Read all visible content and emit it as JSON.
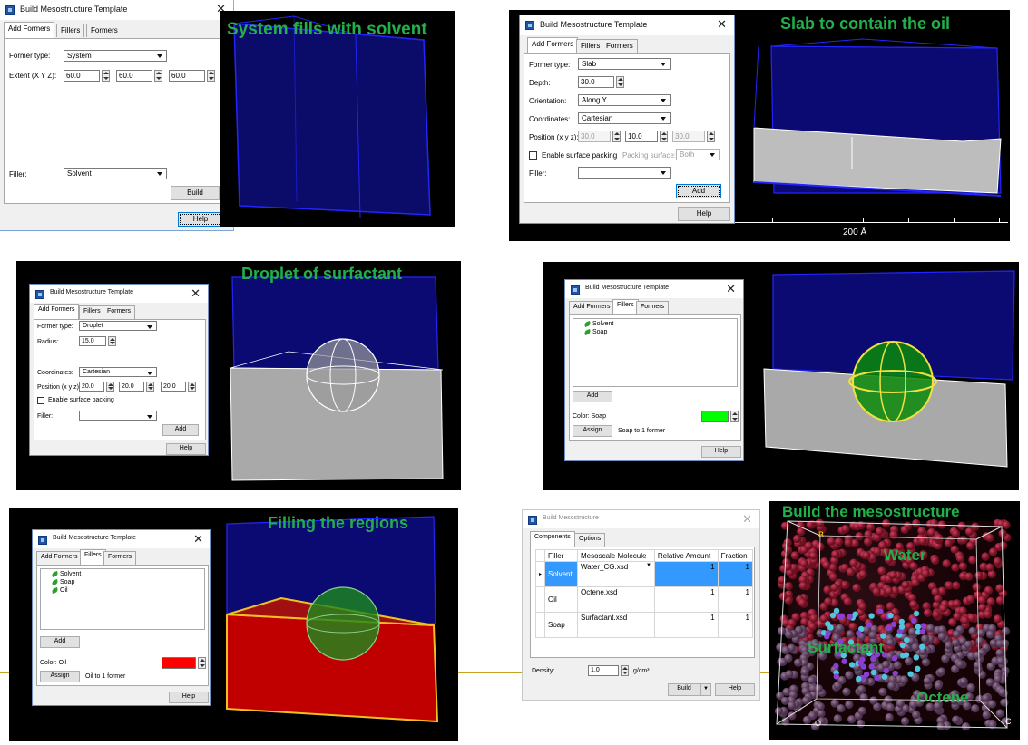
{
  "dialog_title": "Build Mesostructure Template",
  "tabs": {
    "add_formers": "Add Formers",
    "fillers": "Fillers",
    "formers": "Formers"
  },
  "common": {
    "former_type_label": "Former type:",
    "filler_label": "Filler:",
    "coordinates_label": "Coordinates:",
    "position_label": "Position (x y z):",
    "help": "Help",
    "add": "Add",
    "build": "Build",
    "close": "✕",
    "assign": "Assign",
    "cartesian": "Cartesian",
    "enable_surface_packing": "Enable surface packing"
  },
  "panel1": {
    "caption": "System fills with solvent",
    "former_type": "System",
    "extent_label": "Extent (X Y Z):",
    "extent": [
      "60.0",
      "60.0",
      "60.0"
    ],
    "filler": "Solvent"
  },
  "panel2": {
    "caption": "Slab to contain the oil",
    "former_type": "Slab",
    "depth_label": "Depth:",
    "depth": "30.0",
    "orientation_label": "Orientation:",
    "orientation": "Along Y",
    "position": [
      "30.0",
      "10.0",
      "30.0"
    ],
    "packing_surface_label": "Packing surface:",
    "packing_surface": "Both",
    "filler": "",
    "scale_label": "200 Å"
  },
  "panel3": {
    "caption": "Droplet of surfactant",
    "former_type": "Droplet",
    "radius_label": "Radius:",
    "radius": "15.0",
    "position": [
      "20.0",
      "20.0",
      "20.0"
    ],
    "filler": ""
  },
  "panel4": {
    "fillers": [
      "Solvent",
      "Soap"
    ],
    "color_label": "Color: Soap",
    "assign_status": "Soap to 1 former",
    "swatch_color": "#00ff00"
  },
  "panel5": {
    "caption": "Filling the regions",
    "fillers": [
      "Solvent",
      "Soap",
      "Oil"
    ],
    "color_label": "Color: Oil",
    "assign_status": "Oil to 1 former",
    "swatch_color": "#ff0000"
  },
  "panel6": {
    "title": "Build Mesostructure",
    "tabs": [
      "Components",
      "Options"
    ],
    "columns": [
      "Filler",
      "Mesoscale Molecule",
      "Relative Amount",
      "Fraction"
    ],
    "rows": [
      {
        "filler": "Solvent",
        "molecule": "Water_CG.xsd",
        "amount": "1",
        "fraction": "1"
      },
      {
        "filler": "Oil",
        "molecule": "Octene.xsd",
        "amount": "1",
        "fraction": "1"
      },
      {
        "filler": "Soap",
        "molecule": "Surfactant.xsd",
        "amount": "1",
        "fraction": "1"
      }
    ],
    "density_label": "Density:",
    "density": "1.0",
    "density_unit": "g/cm³",
    "build": "Build",
    "help": "Help"
  },
  "panel7": {
    "caption": "Build the mesostructure",
    "labels": {
      "water": "Water",
      "surfactant": "Surfactant",
      "octene": "Octene"
    },
    "axes": {
      "b": "B",
      "o": "O",
      "c": "C"
    }
  },
  "colors": {
    "caption_green": "#22b04a",
    "box_blue": "#1a1aff",
    "water": "#8b1a2e",
    "octene": "#6b4a6b",
    "surfactant": "#8a3fd0",
    "accent_line": "#c9a222"
  }
}
